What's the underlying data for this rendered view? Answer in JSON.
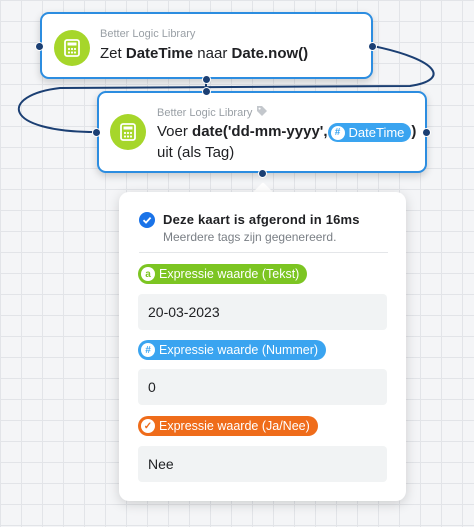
{
  "card1": {
    "library": "Better Logic Library",
    "action_prefix": "Zet",
    "action_var": "DateTime",
    "action_mid": "naar",
    "action_value": "Date.now()",
    "icon": "calculator-icon"
  },
  "card2": {
    "library": "Better Logic Library",
    "library_icon": "tag-icon",
    "verb": "Voer",
    "expression": "date('dd-mm-yyyy',",
    "token_label": "DateTime",
    "token_icon": "hash-icon",
    "close_paren": ")",
    "line2": "uit (als Tag)",
    "icon": "calculator-icon"
  },
  "result": {
    "title": "Deze kaart is afgerond in 16ms",
    "subtitle": "Meerdere tags zijn gegenereerd.",
    "tags": [
      {
        "label": "Expressie waarde (Tekst)",
        "icon_glyph": "a",
        "value": "20-03-2023",
        "color": "#7cc522"
      },
      {
        "label": "Expressie waarde (Nummer)",
        "icon_glyph": "#",
        "value": "0",
        "color": "#3aa4f0"
      },
      {
        "label": "Expressie waarde (Ja/Nee)",
        "icon_glyph": "✓",
        "value": "Nee",
        "color": "#ef6c1a"
      }
    ]
  },
  "colors": {
    "card_border": "#2c8de0",
    "app_icon": "#a6d62a",
    "check": "#1a73e8"
  }
}
